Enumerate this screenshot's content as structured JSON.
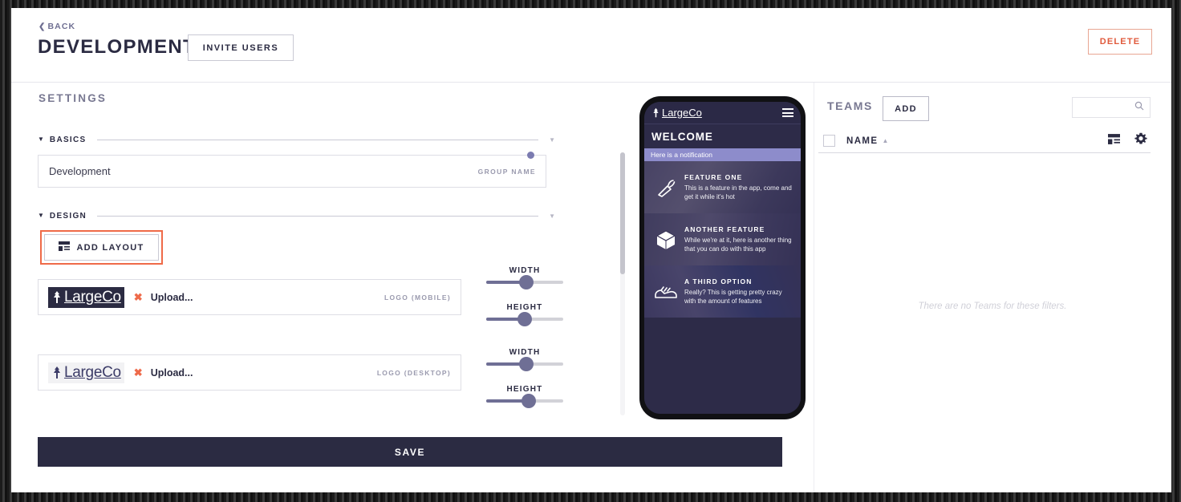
{
  "header": {
    "back_label": "BACK",
    "back_chevron": "chevron-left-icon",
    "title": "DEVELOPMENT",
    "invite_label": "INVITE USERS",
    "delete_label": "DELETE",
    "delete_color": "#e05a3c"
  },
  "settings": {
    "title": "SETTINGS",
    "sections": [
      {
        "label": "BASICS",
        "expanded": true
      },
      {
        "label": "DESIGN",
        "expanded": true
      }
    ],
    "group_name": {
      "value": "Development",
      "label": "GROUP NAME"
    },
    "add_layout_label": "ADD LAYOUT",
    "add_layout_icon": "layout-icon",
    "add_layout_highlight_color": "#ef6a48",
    "logos": [
      {
        "brand": "LargeCo",
        "variant": "dark",
        "clear_icon": "clear-x-icon",
        "upload_label": "Upload...",
        "caption": "LOGO (MOBILE)"
      },
      {
        "brand": "LargeCo",
        "variant": "light",
        "clear_icon": "clear-x-icon",
        "upload_label": "Upload...",
        "caption": "LOGO (DESKTOP)"
      }
    ],
    "sliders": [
      {
        "label": "WIDTH",
        "percent": 52
      },
      {
        "label": "HEIGHT",
        "percent": 50
      },
      {
        "label": "WIDTH",
        "percent": 52
      },
      {
        "label": "HEIGHT",
        "percent": 55
      }
    ],
    "save_label": "SAVE",
    "save_color": "#2b2b42"
  },
  "phone": {
    "brand": "LargeCo",
    "menu_icon": "hamburger-icon",
    "welcome": "WELCOME",
    "notification": "Here is a notification",
    "notification_color": "#8d8ccb",
    "features": [
      {
        "icon": "carrot-icon",
        "title": "FEATURE ONE",
        "description": "This is a feature in the app, come and get it while it's hot"
      },
      {
        "icon": "cube-icon",
        "title": "ANOTHER FEATURE",
        "description": "While we're at it, here is another thing that you can do with this app"
      },
      {
        "icon": "sneaker-icon",
        "title": "A THIRD OPTION",
        "description": "Really? This is getting pretty crazy with the amount of features"
      }
    ]
  },
  "teams": {
    "title": "TEAMS",
    "add_label": "ADD",
    "search_placeholder": "",
    "search_icon": "search-icon",
    "column_name": "NAME",
    "sort_icon": "sort-asc-icon",
    "columns_icon": "columns-icon",
    "settings_icon": "gear-icon",
    "empty_message": "There are no Teams for these filters."
  }
}
